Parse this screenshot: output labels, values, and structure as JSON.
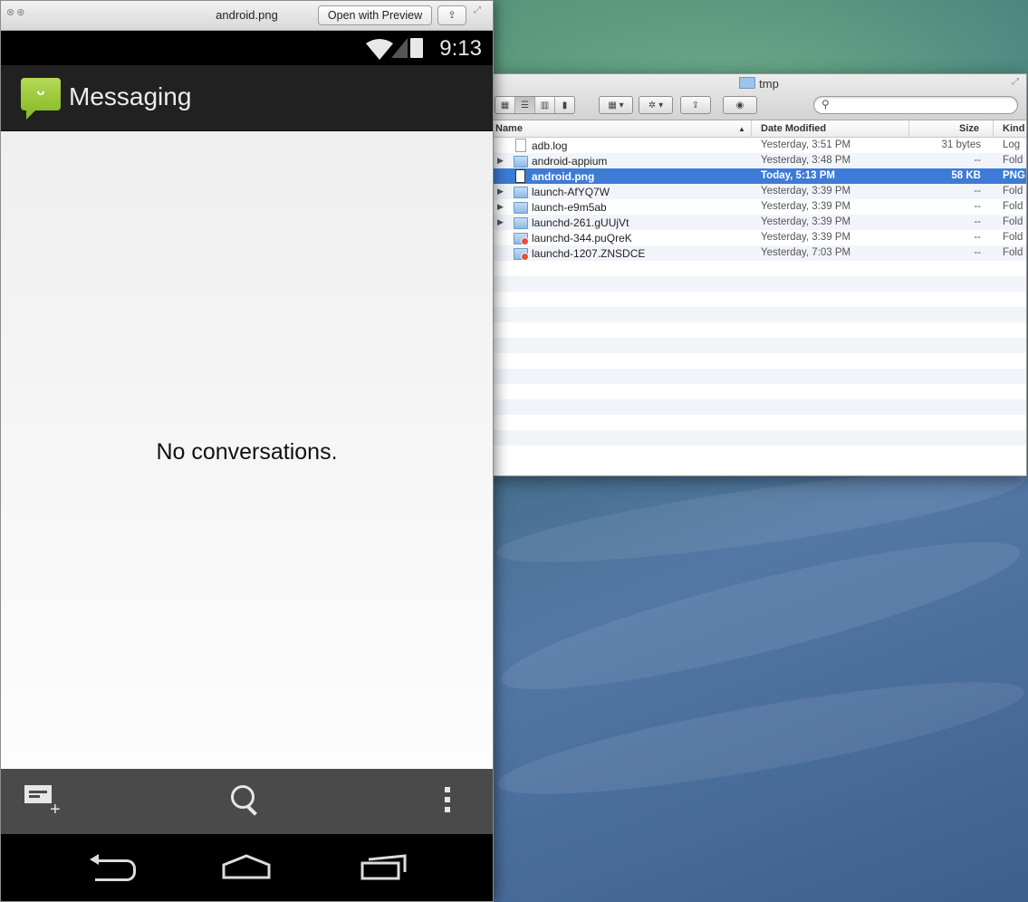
{
  "quicklook": {
    "filename": "android.png",
    "open_button": "Open with Preview",
    "share_icon": "share-icon",
    "fullscreen_icon": "fullscreen-icon"
  },
  "android": {
    "status": {
      "time": "9:13",
      "icons": [
        "wifi-icon",
        "signal-icon",
        "battery-charging-icon"
      ]
    },
    "app_title": "Messaging",
    "empty_message": "No conversations.",
    "bottom_actions": [
      "compose-icon",
      "search-icon",
      "overflow-menu-icon"
    ],
    "nav_buttons": [
      "back-icon",
      "home-icon",
      "recent-apps-icon"
    ]
  },
  "finder": {
    "title": "tmp",
    "columns": {
      "name": "Name",
      "date": "Date Modified",
      "size": "Size",
      "kind": "Kind"
    },
    "rows": [
      {
        "name": "adb.log",
        "date": "Yesterday, 3:51 PM",
        "size": "31 bytes",
        "kind": "Log",
        "type": "doc",
        "expandable": false,
        "selected": false
      },
      {
        "name": "android-appium",
        "date": "Yesterday, 3:48 PM",
        "size": "--",
        "kind": "Fold",
        "type": "folder",
        "expandable": true,
        "selected": false
      },
      {
        "name": "android.png",
        "date": "Today, 5:13 PM",
        "size": "58 KB",
        "kind": "PNG",
        "type": "png",
        "expandable": false,
        "selected": true
      },
      {
        "name": "launch-AfYQ7W",
        "date": "Yesterday, 3:39 PM",
        "size": "--",
        "kind": "Fold",
        "type": "folder",
        "expandable": true,
        "selected": false
      },
      {
        "name": "launch-e9m5ab",
        "date": "Yesterday, 3:39 PM",
        "size": "--",
        "kind": "Fold",
        "type": "folder",
        "expandable": true,
        "selected": false
      },
      {
        "name": "launchd-261.gUUjVt",
        "date": "Yesterday, 3:39 PM",
        "size": "--",
        "kind": "Fold",
        "type": "folder",
        "expandable": true,
        "selected": false
      },
      {
        "name": "launchd-344.puQreK",
        "date": "Yesterday, 3:39 PM",
        "size": "--",
        "kind": "Fold",
        "type": "sock",
        "expandable": false,
        "selected": false
      },
      {
        "name": "launchd-1207.ZNSDCE",
        "date": "Yesterday, 7:03 PM",
        "size": "--",
        "kind": "Fold",
        "type": "sock",
        "expandable": false,
        "selected": false
      }
    ],
    "empty_rows": 13
  }
}
